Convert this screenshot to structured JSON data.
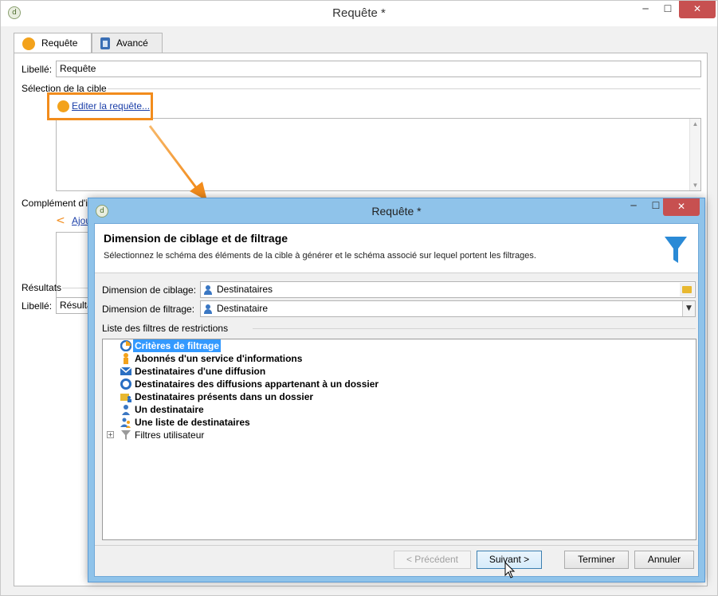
{
  "outer_window": {
    "title": "Requête *",
    "icon_letter": "d",
    "controls": {
      "minimize": "─",
      "maximize": "☐",
      "close": "✕"
    },
    "tabs": [
      {
        "label": "Requête",
        "icon": "orange-dot-icon"
      },
      {
        "label": "Avancé",
        "icon": "clipboard-icon"
      }
    ],
    "form": {
      "libelle_label": "Libellé:",
      "libelle_value": "Requête",
      "target_section": "Sélection de la cible",
      "edit_link": "Editer la requête...",
      "complement_section": "Complément d'informations",
      "add_link": "Ajou",
      "results_section": "Résultats",
      "results_libelle_label": "Libellé:",
      "results_libelle_value": "Résultat"
    }
  },
  "dialog": {
    "title": "Requête *",
    "icon_letter": "d",
    "controls": {
      "minimize": "─",
      "maximize": "☐",
      "close": "✕"
    },
    "heading": "Dimension de ciblage et de filtrage",
    "subheading": "Sélectionnez le schéma des éléments de la cible à générer et le schéma associé sur lequel portent les filtrages.",
    "targeting_label": "Dimension de ciblage:",
    "targeting_value": "Destinataires",
    "filtering_label": "Dimension de filtrage:",
    "filtering_value": "Destinataire",
    "filters_section": "Liste des filtres de restrictions",
    "filters": [
      {
        "label": "Critères de filtrage",
        "icon": "filter-criteria-icon",
        "selected": true,
        "bold": true
      },
      {
        "label": "Abonnés d'un service d'informations",
        "icon": "subscriber-icon",
        "selected": false,
        "bold": true
      },
      {
        "label": "Destinataires d'une diffusion",
        "icon": "envelope-icon",
        "selected": false,
        "bold": true
      },
      {
        "label": "Destinataires des diffusions appartenant à un dossier",
        "icon": "lifebuoy-icon",
        "selected": false,
        "bold": true
      },
      {
        "label": "Destinataires présents dans un dossier",
        "icon": "folder-person-icon",
        "selected": false,
        "bold": true
      },
      {
        "label": "Un destinataire",
        "icon": "person-icon",
        "selected": false,
        "bold": true
      },
      {
        "label": "Une liste de destinataires",
        "icon": "people-icon",
        "selected": false,
        "bold": true
      },
      {
        "label": "Filtres utilisateur",
        "icon": "funnel-gray-icon",
        "selected": false,
        "bold": false,
        "expander": "+"
      }
    ],
    "buttons": {
      "previous": "< Précédent",
      "next": "Suivant >",
      "finish": "Terminer",
      "cancel": "Annuler"
    }
  },
  "colors": {
    "accent_orange": "#f28c1c",
    "dialog_frame": "#8fc3ea",
    "selection": "#3399ff",
    "close_button": "#c75050"
  }
}
